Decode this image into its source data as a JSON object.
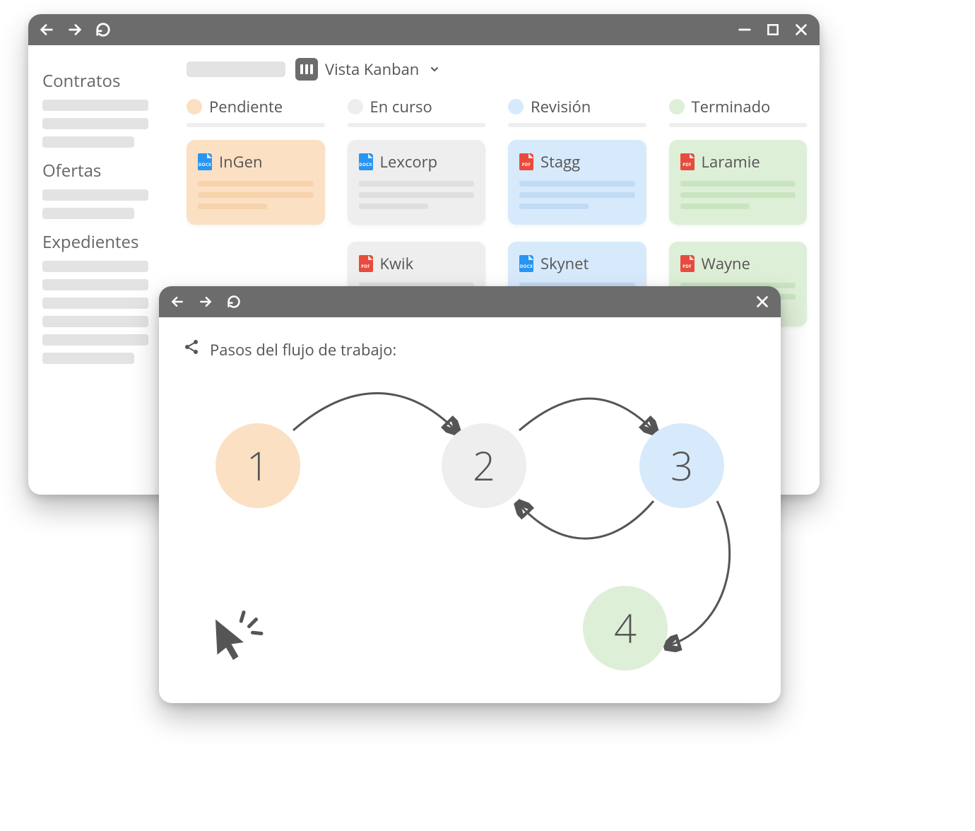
{
  "colors": {
    "orange": "#fbe0c4",
    "grey": "#eeeeee",
    "blue": "#d7eafc",
    "green": "#deefd8"
  },
  "main_window": {
    "view_selector_label": "Vista Kanban",
    "sidebar": {
      "sections": [
        {
          "title": "Contratos"
        },
        {
          "title": "Ofertas"
        },
        {
          "title": "Expedientes"
        }
      ]
    },
    "columns": [
      {
        "label": "Pendiente",
        "color_key": "orange",
        "cards": [
          {
            "title": "InGen",
            "file_type": "DOCX",
            "file_color": "blue"
          }
        ]
      },
      {
        "label": "En curso",
        "color_key": "grey",
        "cards": [
          {
            "title": "Lexcorp",
            "file_type": "DOCX",
            "file_color": "blue"
          },
          {
            "title": "Kwik",
            "file_type": "PDF",
            "file_color": "red"
          }
        ]
      },
      {
        "label": "Revisión",
        "color_key": "blue",
        "cards": [
          {
            "title": "Stagg",
            "file_type": "PDF",
            "file_color": "red"
          },
          {
            "title": "Skynet",
            "file_type": "DOCX",
            "file_color": "blue"
          }
        ]
      },
      {
        "label": "Terminado",
        "color_key": "green",
        "cards": [
          {
            "title": "Laramie",
            "file_type": "PDF",
            "file_color": "red"
          },
          {
            "title": "Wayne",
            "file_type": "PDF",
            "file_color": "red"
          }
        ]
      }
    ]
  },
  "front_window": {
    "title": "Pasos del flujo de trabajo:",
    "steps": [
      {
        "num": "1",
        "color_key": "orange"
      },
      {
        "num": "2",
        "color_key": "grey"
      },
      {
        "num": "3",
        "color_key": "blue"
      },
      {
        "num": "4",
        "color_key": "green"
      }
    ],
    "transitions": [
      {
        "from": 1,
        "to": 2
      },
      {
        "from": 2,
        "to": 3
      },
      {
        "from": 3,
        "to": 2
      },
      {
        "from": 3,
        "to": 4
      }
    ]
  }
}
